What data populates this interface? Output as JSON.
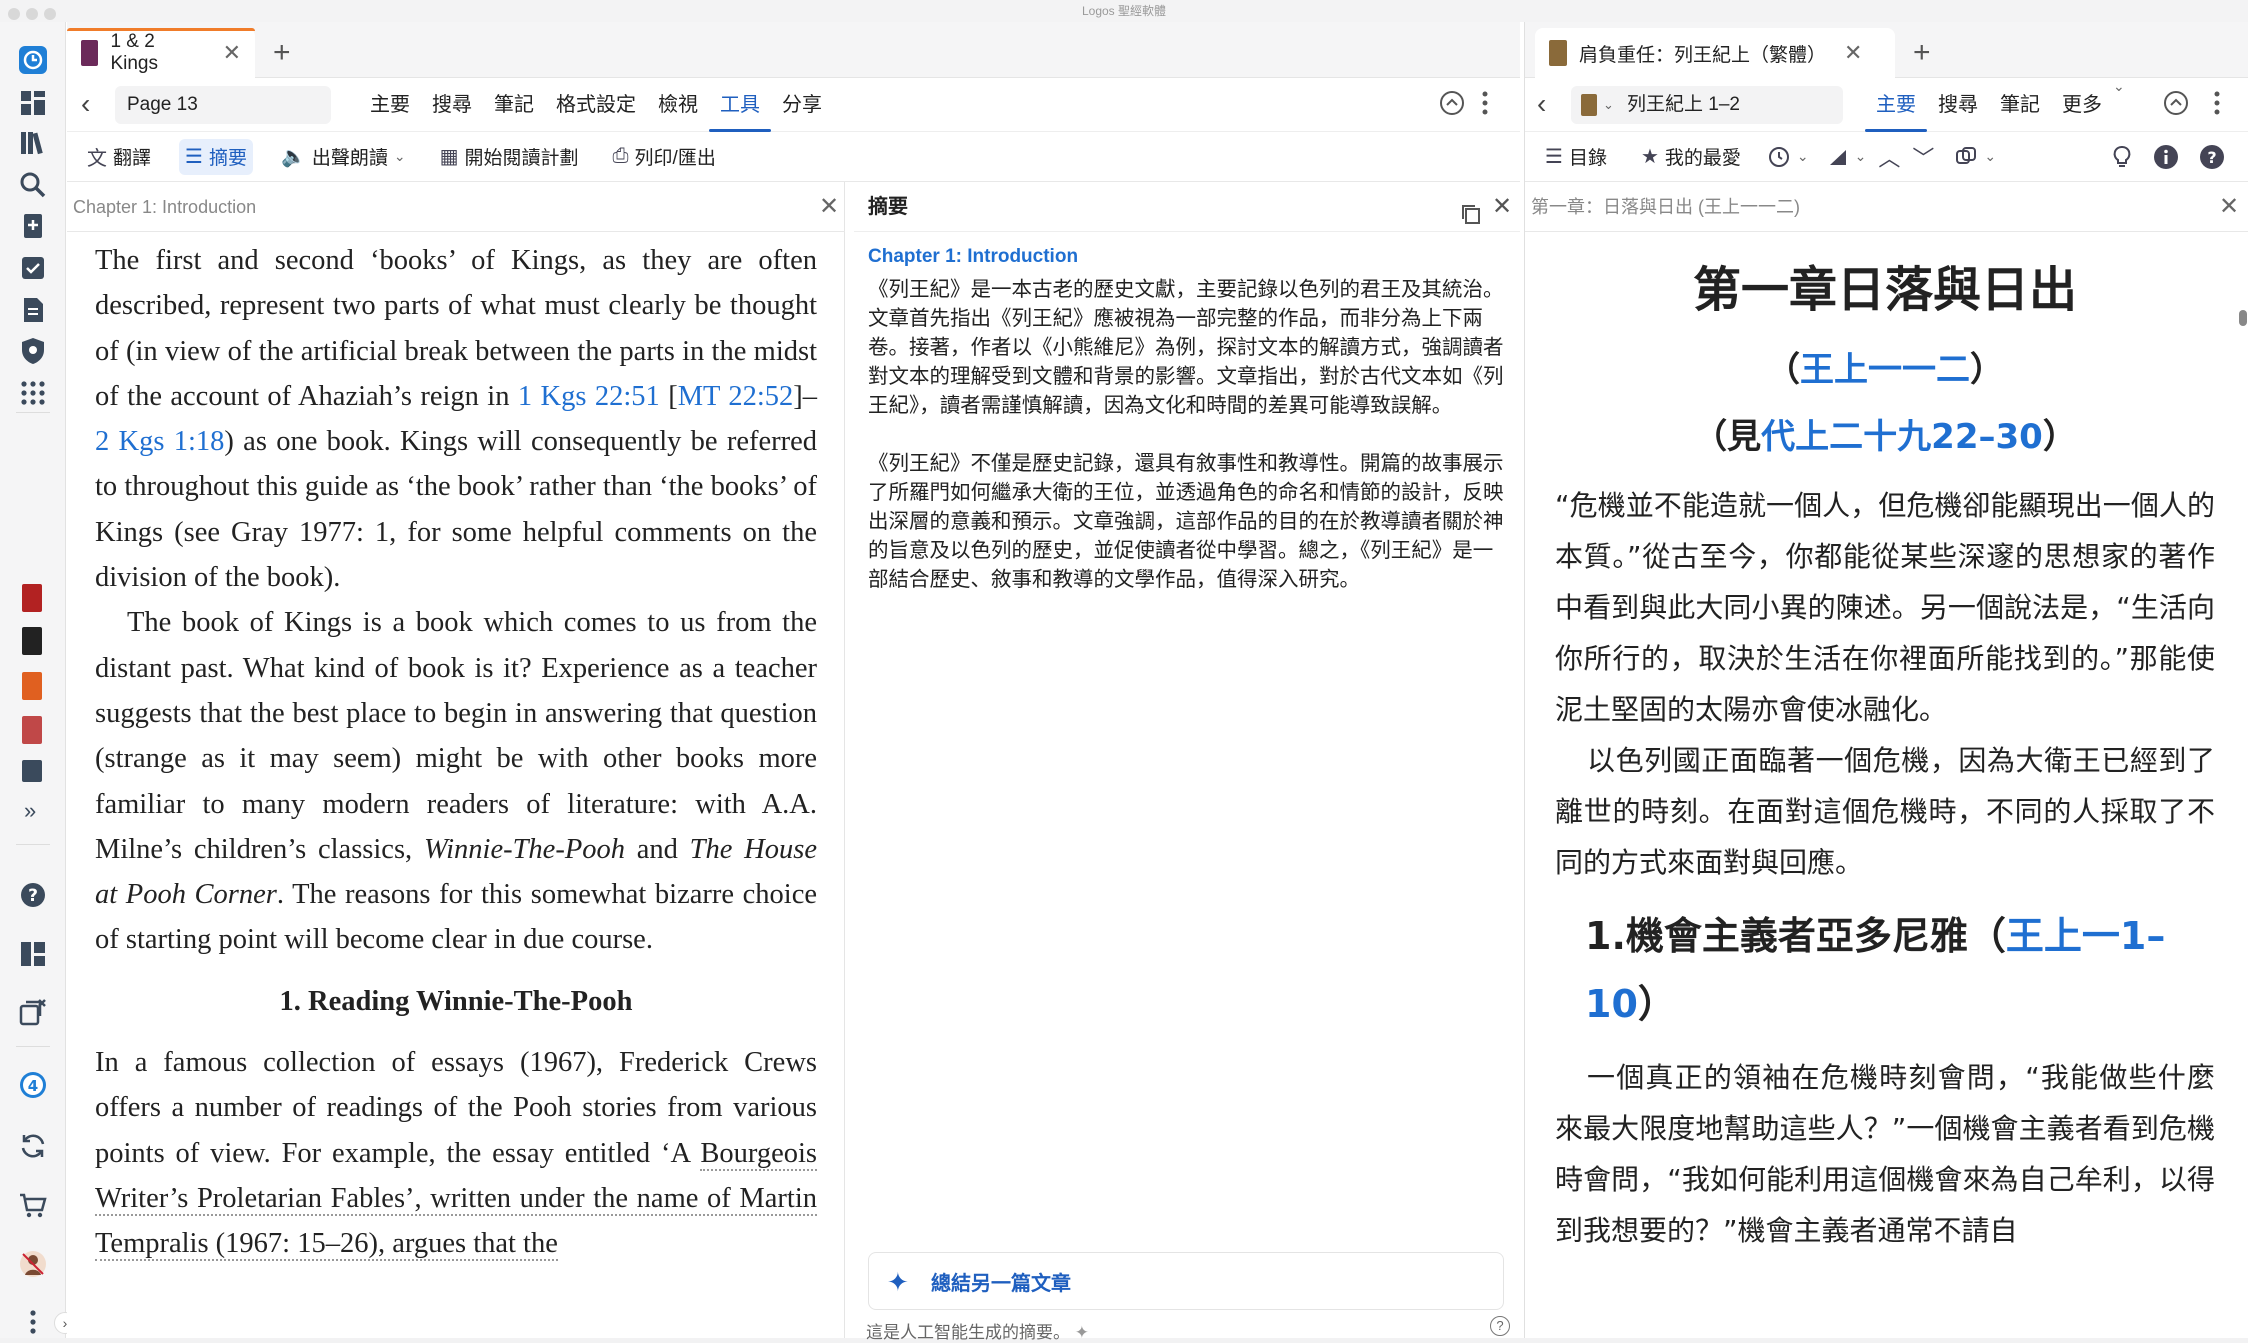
{
  "window": {
    "title": "Logos 聖經軟體"
  },
  "rail": {
    "icons": [
      "logos-icon",
      "dashboard-icon",
      "library-icon",
      "search-icon",
      "add-doc-icon",
      "checklist-icon",
      "document-icon",
      "shield-icon",
      "apps-icon"
    ],
    "books": [
      "#b22222",
      "#222222",
      "#e06020",
      "#c04848",
      "#3a4a5c"
    ],
    "more": "»",
    "bottom_icons": [
      "help-icon",
      "layout-icon",
      "close-panels-icon",
      "notifications-icon",
      "sync-icon",
      "cart-icon",
      "avatar",
      "more-icon"
    ],
    "notification_count": "4"
  },
  "left": {
    "tab": {
      "label": "1 & 2 Kings",
      "close": "✕",
      "plus": "+"
    },
    "nav": {
      "back": "‹",
      "page": "Page 13",
      "menu": [
        "主要",
        "搜尋",
        "筆記",
        "格式設定",
        "檢視",
        "工具",
        "分享"
      ],
      "active_index": 5
    },
    "toolbar": [
      {
        "icon": "文",
        "label": "翻譯"
      },
      {
        "icon": "☰",
        "label": "摘要"
      },
      {
        "icon": "🔈",
        "label": "出聲朗讀"
      },
      {
        "icon": "▦",
        "label": "開始閱讀計劃"
      },
      {
        "icon": "⎙",
        "label": "列印/匯出"
      }
    ],
    "subheader": "Chapter 1: Introduction",
    "reading": {
      "p1_a": "The first and second ‘books’ of Kings, as they are often described, represent two parts of what must clearly be thought of (in view of the artificial break between the parts in the midst of the account of Ahaziah’s reign in ",
      "link1": "1 Kgs 22:51",
      "p1_b": " [",
      "link2": "MT 22:52",
      "p1_c": "]–",
      "link3": "2 Kgs 1:18",
      "p1_d": ") as one book. Kings will consequently be referred to throughout this guide as ‘the book’ rather than ‘the books’ of Kings (see Gray 1977: 1, for some helpful comments on the division of the book).",
      "p2_a": "The book of Kings is a book which comes to us from the distant past. What kind of book is it? Experience as a teacher suggests that the best place to begin in answering that question (strange as it may seem) might be with other books more familiar to many modern readers of literature: with A.A. Milne’s children’s classics, ",
      "p2_i1": "Winnie-The-Pooh",
      "p2_b": " and ",
      "p2_i2": "The House at Pooh Corner",
      "p2_c": ". The reasons for this somewhat bizarre choice of starting point will become clear in due course.",
      "section": "1. Reading Winnie-The-Pooh",
      "p3_a": "In a famous collection of essays (1967), Frederick Crews offers a number of readings of the Pooh stories from various points of view. For example, the essay entitled ‘A ",
      "p3_u": "Bourgeois Writer’s Proletarian Fables’, written under the name of Martin Tempralis (1967: 15–26), argues that the"
    },
    "summary": {
      "title": "摘要",
      "chapter": "Chapter 1: Introduction",
      "para1": "《列王紀》是一本古老的歷史文獻，主要記錄以色列的君王及其統治。文章首先指出《列王紀》應被視為一部完整的作品，而非分為上下兩卷。接著，作者以《小熊維尼》為例，探討文本的解讀方式，強調讀者對文本的理解受到文體和背景的影響。文章指出，對於古代文本如《列王紀》，讀者需謹慎解讀，因為文化和時間的差異可能導致誤解。",
      "para2": "《列王紀》不僅是歷史記錄，還具有敘事性和教導性。開篇的故事展示了所羅門如何繼承大衛的王位，並透過角色的命名和情節的設計，反映出深層的意義和預示。文章強調，這部作品的目的在於教導讀者關於神的旨意及以色列的歷史，並促使讀者從中學習。總之，《列王紀》是一部結合歷史、敘事和教導的文學作品，值得深入研究。",
      "button": "總結另一篇文章",
      "footer": "這是人工智能生成的摘要。"
    }
  },
  "right": {
    "tab": {
      "label": "肩負重任：列王紀上（繁體）",
      "close": "✕",
      "plus": "+"
    },
    "nav": {
      "back": "‹",
      "ref": "列王紀上 1–2",
      "menu": [
        "主要",
        "搜尋",
        "筆記",
        "更多"
      ],
      "active_index": 0
    },
    "toolbar": [
      {
        "icon": "☰",
        "label": "目錄"
      },
      {
        "icon": "★",
        "label": "我的最愛"
      }
    ],
    "subheader": "第一章：日落與日出 (王上一一二)",
    "content": {
      "title": "第一章日落與日出",
      "ref1_open": "（",
      "ref1": "王上一一二",
      "ref1_close": "）",
      "ref2_open": "（見",
      "ref2": "代上二十九22–30",
      "ref2_close": "）",
      "p1": "“危機並不能造就一個人，但危機卻能顯現出一個人的本質。”從古至今，你都能從某些深邃的思想家的著作中看到與此大同小異的陳述。另一個說法是，“生活向你所行的，取決於生活在你裡面所能找到的。”那能使泥土堅固的太陽亦會使冰融化。",
      "p2": "以色列國正面臨著一個危機，因為大衛王已經到了離世的時刻。在面對這個危機時，不同的人採取了不同的方式來面對與回應。",
      "h2_a": "1.機會主義者亞多尼雅（",
      "h2_ref": "王上一1–10",
      "h2_b": "）",
      "p3": "一個真正的領袖在危機時刻會問，“我能做些什麼來最大限度地幫助這些人？”一個機會主義者看到危機時會問，“我如何能利用這個機會來為自己牟利，以得到我想要的？”機會主義者通常不請自"
    }
  }
}
